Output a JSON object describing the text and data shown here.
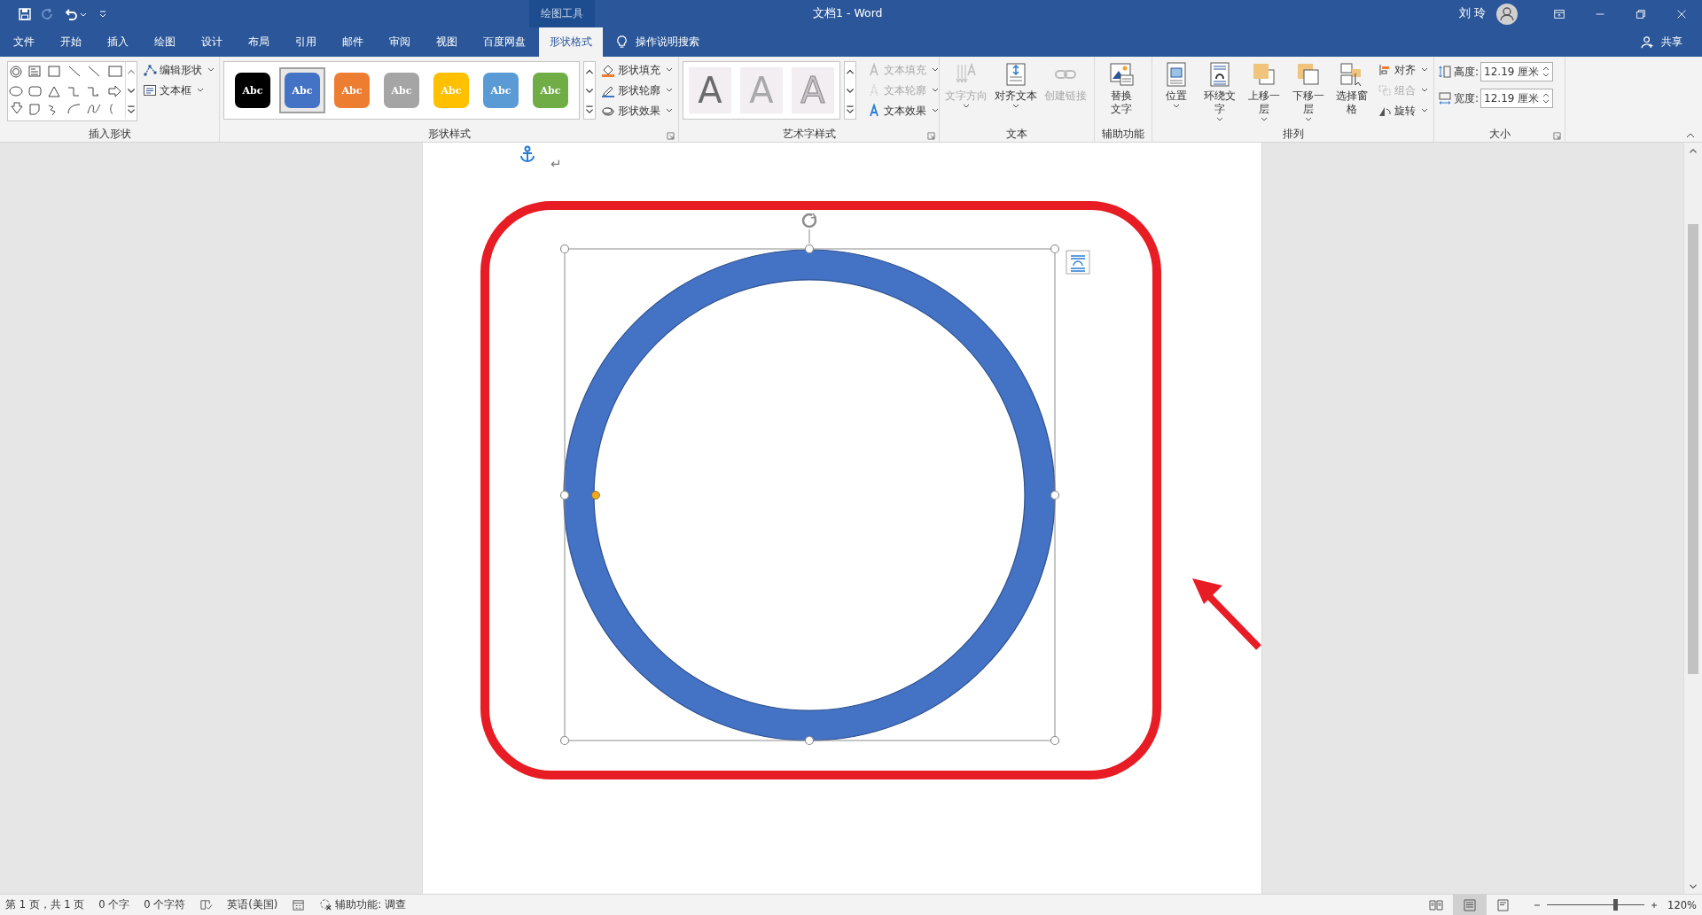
{
  "window": {
    "title": "文档1 - Word",
    "context_label": "绘图工具",
    "user": "刘 玲",
    "share": "共享"
  },
  "tabs": [
    {
      "label": "文件",
      "selected": false
    },
    {
      "label": "开始",
      "selected": false
    },
    {
      "label": "插入",
      "selected": false
    },
    {
      "label": "绘图",
      "selected": false
    },
    {
      "label": "设计",
      "selected": false
    },
    {
      "label": "布局",
      "selected": false
    },
    {
      "label": "引用",
      "selected": false
    },
    {
      "label": "邮件",
      "selected": false
    },
    {
      "label": "审阅",
      "selected": false
    },
    {
      "label": "视图",
      "selected": false
    },
    {
      "label": "百度网盘",
      "selected": false
    },
    {
      "label": "形状格式",
      "selected": true
    }
  ],
  "search": {
    "label": "操作说明搜索"
  },
  "ribbon": {
    "groups": [
      {
        "label": "插入形状",
        "kind": "shapes",
        "buttons": [
          {
            "label": "编辑形状",
            "disabled": false,
            "dropdown": true
          },
          {
            "label": "文本框",
            "disabled": false,
            "dropdown": true
          }
        ]
      },
      {
        "label": "形状样式",
        "kind": "styles",
        "swatches": [
          {
            "label": "Abc",
            "color": "#000000",
            "selected": false
          },
          {
            "label": "Abc",
            "color": "#4472c4",
            "selected": true
          },
          {
            "label": "Abc",
            "color": "#ed7d31",
            "selected": false
          },
          {
            "label": "Abc",
            "color": "#a5a5a5",
            "selected": false
          },
          {
            "label": "Abc",
            "color": "#ffc000",
            "selected": false
          },
          {
            "label": "Abc",
            "color": "#5b9bd5",
            "selected": false
          },
          {
            "label": "Abc",
            "color": "#70ad47",
            "selected": false
          }
        ],
        "buttons": [
          {
            "label": "形状填充",
            "disabled": false,
            "dropdown": true
          },
          {
            "label": "形状轮廓",
            "disabled": false,
            "dropdown": true
          },
          {
            "label": "形状效果",
            "disabled": false,
            "dropdown": true
          }
        ]
      },
      {
        "label": "艺术字样式",
        "kind": "wordart",
        "previews": [
          "A",
          "A",
          "A"
        ],
        "buttons": [
          {
            "label": "文本填充",
            "disabled": true,
            "dropdown": true
          },
          {
            "label": "文本轮廓",
            "disabled": true,
            "dropdown": true
          },
          {
            "label": "文本效果",
            "disabled": false,
            "dropdown": true
          }
        ]
      },
      {
        "label": "文本",
        "kind": "large",
        "buttons": [
          {
            "label": "文字方向",
            "disabled": true,
            "dropdown": true
          },
          {
            "label": "对齐文本",
            "disabled": false,
            "dropdown": true
          },
          {
            "label": "创建链接",
            "disabled": true,
            "dropdown": false
          }
        ]
      },
      {
        "label": "辅助功能",
        "kind": "large",
        "buttons": [
          {
            "label": "替换文字",
            "disabled": false,
            "dropdown": false
          }
        ]
      },
      {
        "label": "排列",
        "kind": "arrange",
        "buttons": [
          {
            "label": "位置",
            "disabled": false,
            "dropdown": true
          },
          {
            "label": "环绕文字",
            "disabled": false,
            "dropdown": true
          },
          {
            "label": "上移一层",
            "disabled": false,
            "dropdown": true
          },
          {
            "label": "下移一层",
            "disabled": false,
            "dropdown": true
          },
          {
            "label": "选择窗格",
            "disabled": false,
            "dropdown": false
          }
        ],
        "small_buttons": [
          {
            "label": "对齐",
            "disabled": false,
            "dropdown": true
          },
          {
            "label": "组合",
            "disabled": true,
            "dropdown": true
          },
          {
            "label": "旋转",
            "disabled": false,
            "dropdown": true
          }
        ]
      },
      {
        "label": "大小",
        "kind": "size",
        "fields": [
          {
            "label": "高度:",
            "value": "12.19 厘米"
          },
          {
            "label": "宽度:",
            "value": "12.19 厘米"
          }
        ]
      }
    ]
  },
  "document": {
    "paragraph_mark": "↵"
  },
  "status_bar": {
    "items": [
      "第 1 页，共 1 页",
      "0 个字",
      "0 个字符"
    ],
    "language": "英语(美国)",
    "accessibility": "辅助功能: 调查",
    "views": [
      {
        "selected": false
      },
      {
        "selected": true
      },
      {
        "selected": false
      }
    ],
    "zoom": {
      "level": 0.7,
      "reading": "120%"
    }
  }
}
